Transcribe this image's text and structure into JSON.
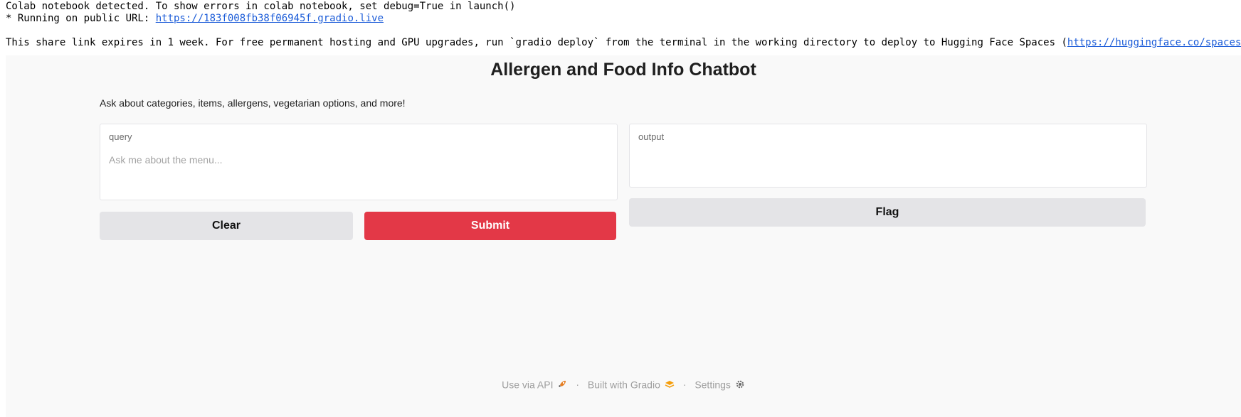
{
  "console": {
    "line1": "Colab notebook detected. To show errors in colab notebook, set debug=True in launch()",
    "line2_prefix": "* Running on public URL: ",
    "line2_link": "https://183f008fb38f06945f.gradio.live",
    "line3_text": "This share link expires in 1 week. For free permanent hosting and GPU upgrades, run `gradio deploy` from the terminal in the working directory to deploy to Hugging Face Spaces (",
    "line3_link": "https://huggingface.co/spaces"
  },
  "app": {
    "title": "Allergen and Food Info Chatbot",
    "description": "Ask about categories, items, allergens, vegetarian options, and more!",
    "query": {
      "label": "query",
      "placeholder": "Ask me about the menu...",
      "value": ""
    },
    "output": {
      "label": "output",
      "value": ""
    },
    "buttons": {
      "clear": "Clear",
      "submit": "Submit",
      "flag": "Flag"
    },
    "colors": {
      "primary": "#e33847",
      "secondary": "#e4e4e7",
      "background": "#f9f9f9"
    }
  },
  "footer": {
    "api": "Use via API",
    "built": "Built with Gradio",
    "settings": "Settings",
    "separator": "·",
    "icons": [
      "rocket-icon",
      "gradio-logo-icon",
      "gear-icon"
    ]
  }
}
